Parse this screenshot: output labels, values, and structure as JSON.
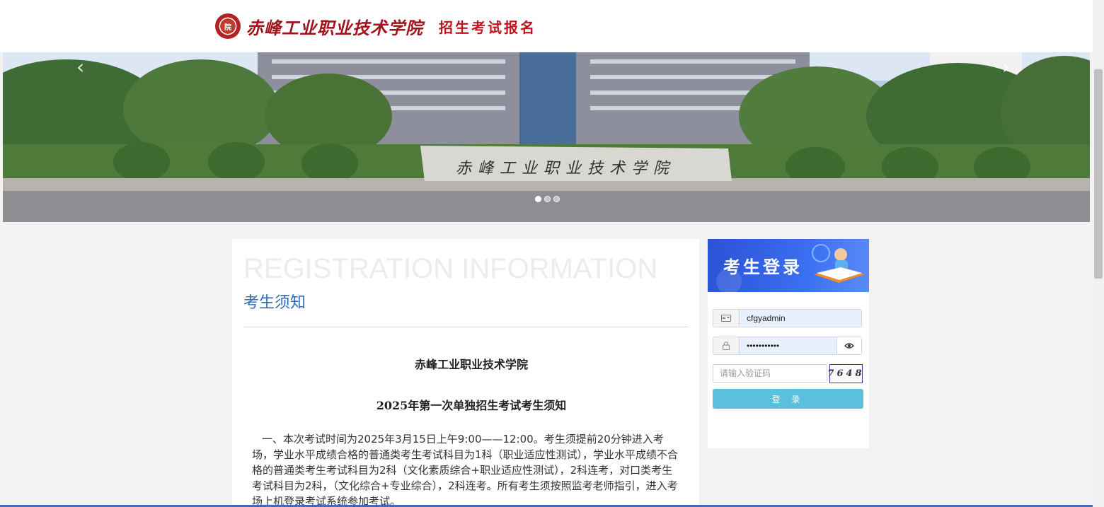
{
  "header": {
    "seal_text": "院",
    "school_name": "赤峰工业职业技术学院",
    "system_name": "招生考试报名"
  },
  "banner": {
    "stone_text": "赤峰工业职业技术学院",
    "prev_icon": "chevron-left-icon",
    "next_icon": "chevron-right-icon",
    "slide_count": 3,
    "active_slide": 1
  },
  "notice": {
    "watermark": "REGISTRATION INFORMATION",
    "title": "考生须知",
    "school": "赤峰工业职业技术学院",
    "heading": "2025年第一次单独招生考试考生须知",
    "paragraph": "一、本次考试时间为2025年3月15日上午9:00——12:00。考生须提前20分钟进入考场，学业水平成绩合格的普通类考生考试科目为1科（职业适应性测试），学业水平成绩不合格的普通类考生考试科目为2科（文化素质综合+职业适应性测试），2科连考，对口类考生考试科目为2科，（文化综合+专业综合），2科连考。所有考生须按照监考老师指引，进入考场上机登录考试系统参加考试。"
  },
  "login": {
    "banner_title": "考生登录",
    "username_icon": "id-card-icon",
    "username_value": "cfgyadmin",
    "password_icon": "lock-icon",
    "password_value": "•••••••••••",
    "eye_icon": "eye-icon",
    "captcha_placeholder": "请输入验证码",
    "captcha_code": "7648",
    "submit_label": "登 录"
  },
  "colors": {
    "brand_red": "#a0141e",
    "link_blue": "#2f6db5",
    "button_cyan": "#5bc0de",
    "login_banner_blue": "#2a52d6"
  }
}
